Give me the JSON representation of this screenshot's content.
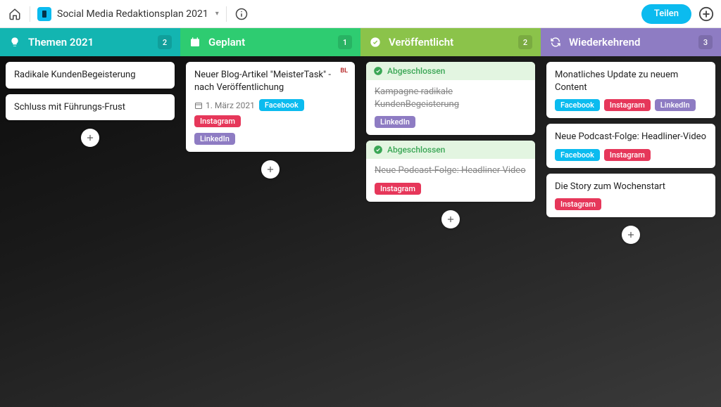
{
  "header": {
    "board_title": "Social Media Redaktionsplan 2021",
    "share_label": "Teilen"
  },
  "columns": [
    {
      "key": "themen",
      "title": "Themen 2021",
      "count": "2",
      "cards": [
        {
          "title": "Radikale KundenBegeisterung"
        },
        {
          "title": "Schluss mit Führungs-Frust"
        }
      ]
    },
    {
      "key": "geplant",
      "title": "Geplant",
      "count": "1",
      "cards": [
        {
          "title": "Neuer Blog-Artikel \"MeisterTask\" - nach Veröffentlichung",
          "date": "1. März 2021",
          "avatar": "BL",
          "tags": [
            "Facebook",
            "Instagram",
            "LinkedIn"
          ]
        }
      ]
    },
    {
      "key": "veroeff",
      "title": "Veröffentlicht",
      "count": "2",
      "done_label": "Abgeschlossen",
      "cards": [
        {
          "completed": true,
          "title": "Kampagne radikale KundenBegeisterung",
          "tags": [
            "LinkedIn"
          ]
        },
        {
          "completed": true,
          "title": "Neue Podcast-Folge: Headliner Video",
          "tags": [
            "Instagram"
          ]
        }
      ]
    },
    {
      "key": "wieder",
      "title": "Wiederkehrend",
      "count": "3",
      "cards": [
        {
          "title": "Monatliches Update zu neuem Content",
          "tags": [
            "Facebook",
            "Instagram",
            "LinkedIn"
          ]
        },
        {
          "title": "Neue Podcast-Folge: Headliner-Video",
          "tags": [
            "Facebook",
            "Instagram"
          ]
        },
        {
          "title": "Die Story zum Wochenstart",
          "tags": [
            "Instagram"
          ]
        }
      ]
    }
  ]
}
